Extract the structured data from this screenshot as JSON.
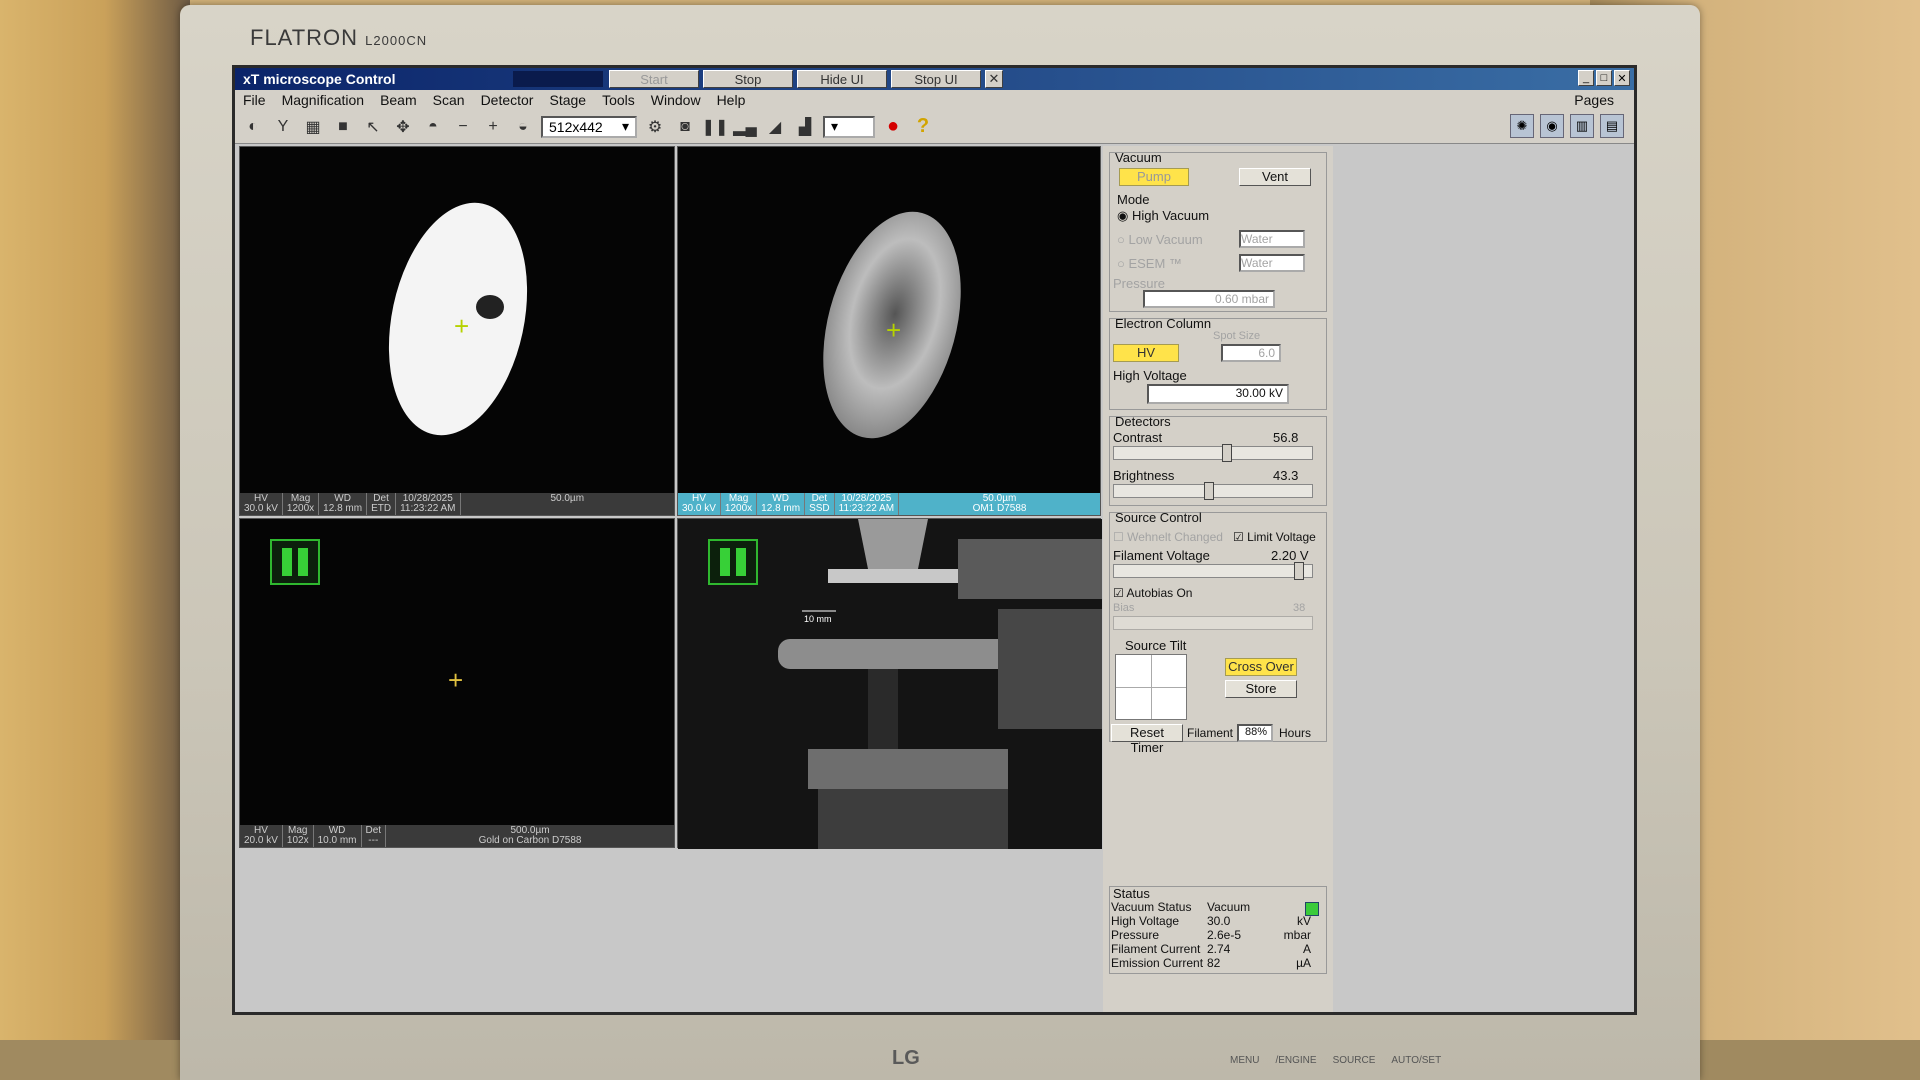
{
  "monitor": {
    "brand": "FLATRON",
    "model": "L2000CN",
    "logo": "LG",
    "buttons": [
      "MENU",
      "/ENGINE",
      "SOURCE",
      "AUTO/SET"
    ]
  },
  "app": {
    "title": "xT microscope Control",
    "title_buttons": {
      "start": "Start",
      "stop": "Stop",
      "hide_ui": "Hide UI",
      "stop_ui": "Stop UI",
      "close": "✕"
    },
    "window_controls": [
      "_",
      "□",
      "✕"
    ]
  },
  "menu": [
    "File",
    "Magnification",
    "Beam",
    "Scan",
    "Detector",
    "Stage",
    "Tools",
    "Window",
    "Help"
  ],
  "menu_pages": "Pages",
  "toolbar": {
    "resolution": "512x442"
  },
  "quad1": {
    "hv_label": "HV",
    "hv": "30.0 kV",
    "mag_label": "Mag",
    "mag": "1200x",
    "wd_label": "WD",
    "wd": "12.8 mm",
    "det_label": "Det",
    "det": "ETD",
    "date": "10/28/2025",
    "time": "11:23:22 AM",
    "scale": "50.0µm"
  },
  "quad2": {
    "hv_label": "HV",
    "hv": "30.0 kV",
    "mag_label": "Mag",
    "mag": "1200x",
    "wd_label": "WD",
    "wd": "12.8 mm",
    "det_label": "Det",
    "det": "SSD",
    "date": "10/28/2025",
    "time": "11:23:22 AM",
    "scale": "50.0µm",
    "label": "OM1 D7588"
  },
  "quad3": {
    "hv_label": "HV",
    "hv": "20.0 kV",
    "mag_label": "Mag",
    "mag": "102x",
    "wd_label": "WD",
    "wd": "10.0 mm",
    "det_label": "Det",
    "det": "---",
    "scale": "500.0µm",
    "label": "Gold on Carbon D7588"
  },
  "quad4": {
    "scale": "10 mm"
  },
  "panel": {
    "vacuum_title": "Vacuum",
    "pump": "Pump",
    "vent": "Vent",
    "mode_title": "Mode",
    "high_vacuum": "High Vacuum",
    "low_vacuum": "Low Vacuum",
    "esem": "ESEM ™",
    "water1": "Water",
    "water2": "Water",
    "pressure_title": "Pressure",
    "pressure_value": "0.60",
    "pressure_unit": "mbar",
    "column_title": "Electron Column",
    "spot_size_label": "Spot Size",
    "hv_button": "HV",
    "spot_size": "6.0",
    "high_voltage_label": "High Voltage",
    "high_voltage": "30.00 kV",
    "detectors_title": "Detectors",
    "contrast_label": "Contrast",
    "contrast": "56.8",
    "brightness_label": "Brightness",
    "brightness": "43.3",
    "source_title": "Source Control",
    "wehnelt": "Wehnelt Changed",
    "limit_voltage": "Limit Voltage",
    "filament_voltage_label": "Filament Voltage",
    "filament_voltage": "2.20 V",
    "autobias": "Autobias On",
    "bias_label": "Bias",
    "bias": "38",
    "tilt_title": "Source Tilt",
    "cross_over": "Cross Over",
    "store": "Store",
    "reset_timer": "Reset Timer",
    "filament_label": "Filament",
    "filament_pct": "88%",
    "hours": "Hours"
  },
  "status": {
    "title": "Status",
    "rows": [
      {
        "k": "Vacuum Status",
        "v": "Vacuum",
        "u": ""
      },
      {
        "k": "High Voltage",
        "v": "30.0",
        "u": "kV"
      },
      {
        "k": "Pressure",
        "v": "2.6e-5",
        "u": "mbar"
      },
      {
        "k": "Filament Current",
        "v": "2.74",
        "u": "A"
      },
      {
        "k": "Emission Current",
        "v": "82",
        "u": "µA"
      }
    ],
    "vacuum_ok_color": "#3acb3a"
  },
  "colors": {
    "titlebar_start": "#0b246a",
    "titlebar_end": "#3a6ea5",
    "accent_yellow": "#ffe34a",
    "databar_blue": "#4fb2c9"
  }
}
